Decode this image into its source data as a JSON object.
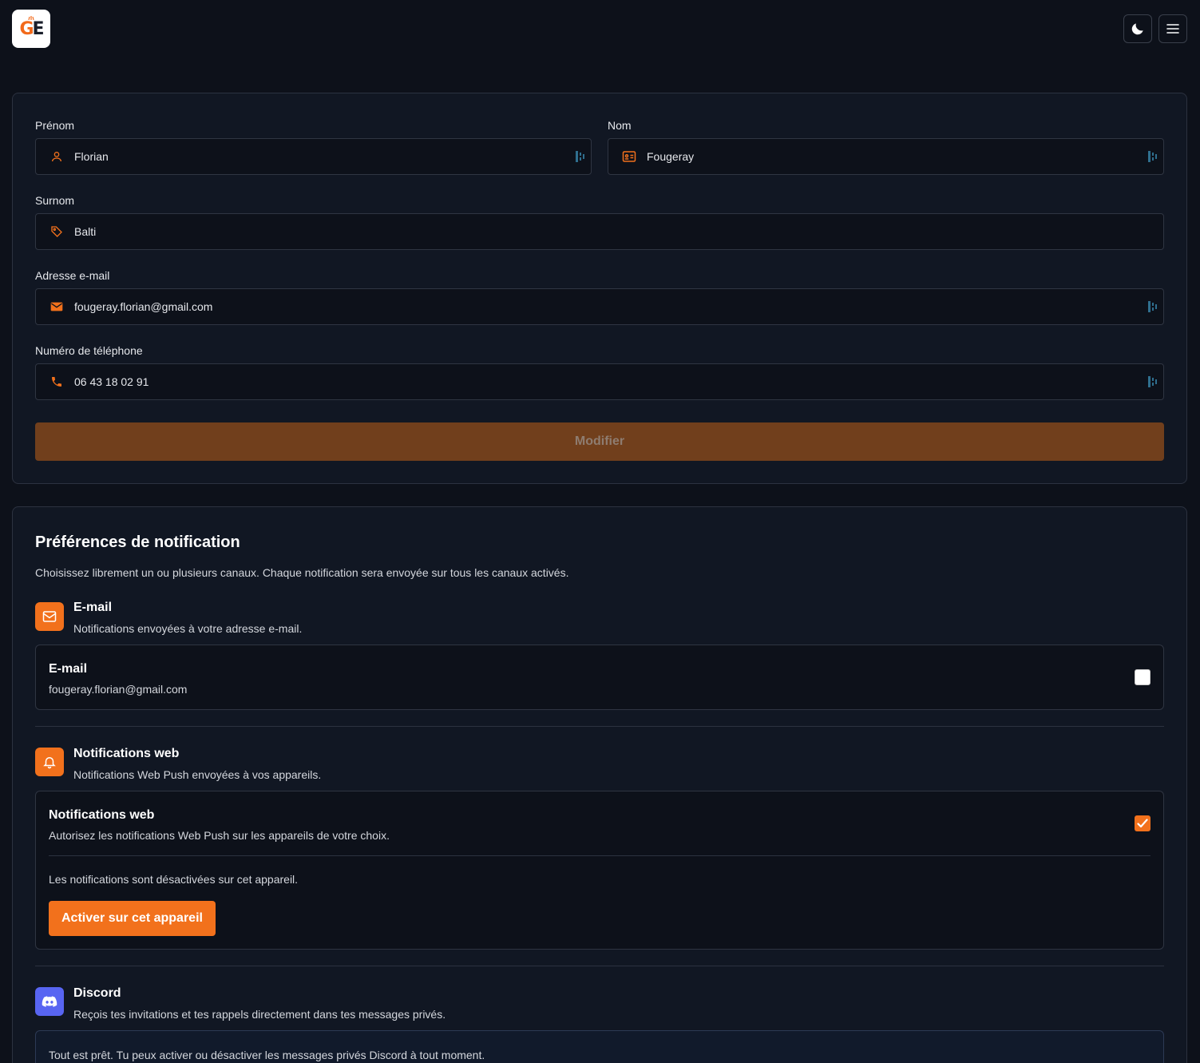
{
  "header": {
    "logo_letter_g": "G",
    "logo_letter_e": "E",
    "theme_icon": "moon-icon",
    "menu_icon": "hamburger-menu-icon"
  },
  "profile": {
    "first_name": {
      "label": "Prénom",
      "value": "Florian",
      "icon": "user-icon"
    },
    "last_name": {
      "label": "Nom",
      "value": "Fougeray",
      "icon": "id-card-icon"
    },
    "nickname": {
      "label": "Surnom",
      "value": "Balti",
      "icon": "tag-icon"
    },
    "email": {
      "label": "Adresse e-mail",
      "value": "fougeray.florian@gmail.com",
      "icon": "envelope-icon"
    },
    "phone": {
      "label": "Numéro de téléphone",
      "value": "06 43 18 02 91",
      "icon": "phone-icon"
    },
    "submit_label": "Modifier"
  },
  "notifications": {
    "title": "Préférences de notification",
    "description": "Choisissez librement un ou plusieurs canaux. Chaque notification sera envoyée sur tous les canaux activés.",
    "email": {
      "title": "E-mail",
      "description": "Notifications envoyées à votre adresse e-mail.",
      "box_title": "E-mail",
      "box_value": "fougeray.florian@gmail.com",
      "enabled": false
    },
    "web": {
      "title": "Notifications web",
      "description": "Notifications Web Push envoyées à vos appareils.",
      "box_title": "Notifications web",
      "box_description": "Autorisez les notifications Web Push sur les appareils de votre choix.",
      "enabled": true,
      "device_status": "Les notifications sont désactivées sur cet appareil.",
      "activate_label": "Activer sur cet appareil"
    },
    "discord": {
      "title": "Discord",
      "description": "Reçois tes invitations et tes rappels directement dans tes messages privés.",
      "box_text": "Tout est prêt. Tu peux activer ou désactiver les messages privés Discord à tout moment."
    }
  },
  "colors": {
    "background": "#0d111a",
    "card": "#111723",
    "accent": "#f2711c",
    "discord": "#5865f2"
  }
}
